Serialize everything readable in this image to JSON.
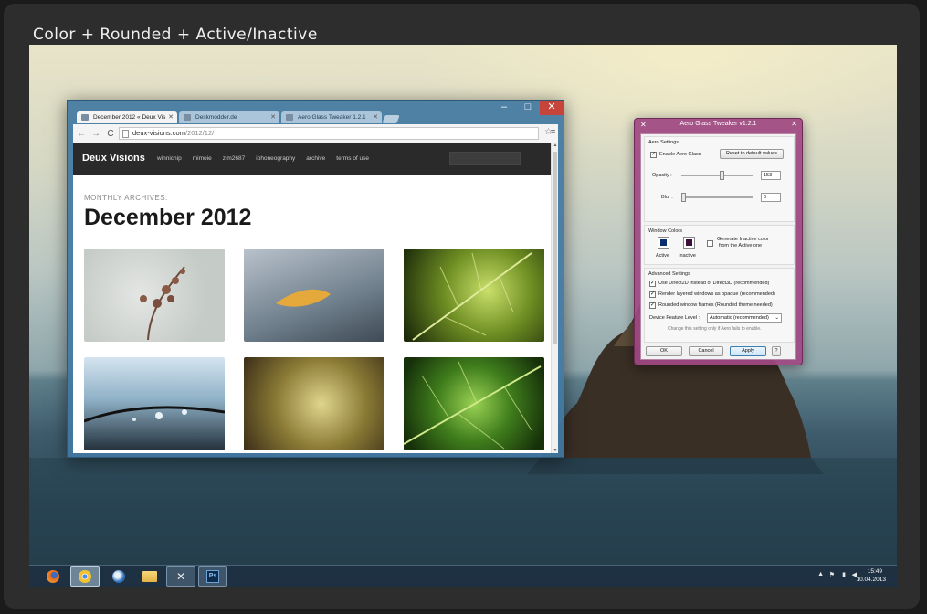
{
  "frame": {
    "title": "Color + Rounded + Active/Inactive"
  },
  "browser": {
    "tabs": [
      {
        "label": "December 2012 « Deux Vis",
        "active": true
      },
      {
        "label": "Deskmodder.de",
        "active": false
      },
      {
        "label": "Aero Glass Tweaker 1.2.1",
        "active": false
      }
    ],
    "url_host": "deux-visions.com",
    "url_path": "/2012/12/",
    "site": {
      "brand": "Deux Visions",
      "nav": [
        "winnichip",
        "mimoie",
        "zim2687",
        "iphoneography",
        "archive",
        "terms of use"
      ],
      "archive_label": "MONTHLY ARCHIVES:",
      "archive_title": "December 2012"
    }
  },
  "tweaker": {
    "title": "Aero Glass Tweaker v1.2.1",
    "aero_settings": "Aero Settings",
    "enable_aero_glass": "Enable Aero Glass",
    "enable_aero_glass_checked": true,
    "reset_label": "Reset to default values",
    "opacity_label": "Opacity :",
    "opacity_value": "153",
    "blur_label": "Blur :",
    "blur_value": "0",
    "window_colors": "Window Colors",
    "active_label": "Active",
    "inactive_label": "Inactive",
    "active_color": "#0b2f6e",
    "inactive_color": "#3a0f3a",
    "generate_inactive_line1": "Generate Inactive color",
    "generate_inactive_line2": "from the Active one",
    "advanced_settings": "Advanced Settings",
    "opt_direct2d": "Use Direct2D instead of Direct3D (recommended)",
    "opt_layered": "Render layered windows as opaque (recommended)",
    "opt_rounded": "Rounded window frames (Rounded theme needed)",
    "device_feature_label": "Device Feature Level :",
    "device_feature_value": "Automatic (recommended)",
    "device_hint": "Change this setting only if Aero fails to enable.",
    "ok_label": "OK",
    "cancel_label": "Cancel",
    "apply_label": "Apply",
    "help_label": "?"
  },
  "taskbar": {
    "apps": [
      "firefox-icon",
      "chrome-icon",
      "thunderbird-icon",
      "explorer-icon",
      "tweaker-icon",
      "photoshop-icon"
    ],
    "photoshop_label": "Ps",
    "clock_time": "15:49",
    "clock_date": "10.04.2013"
  }
}
